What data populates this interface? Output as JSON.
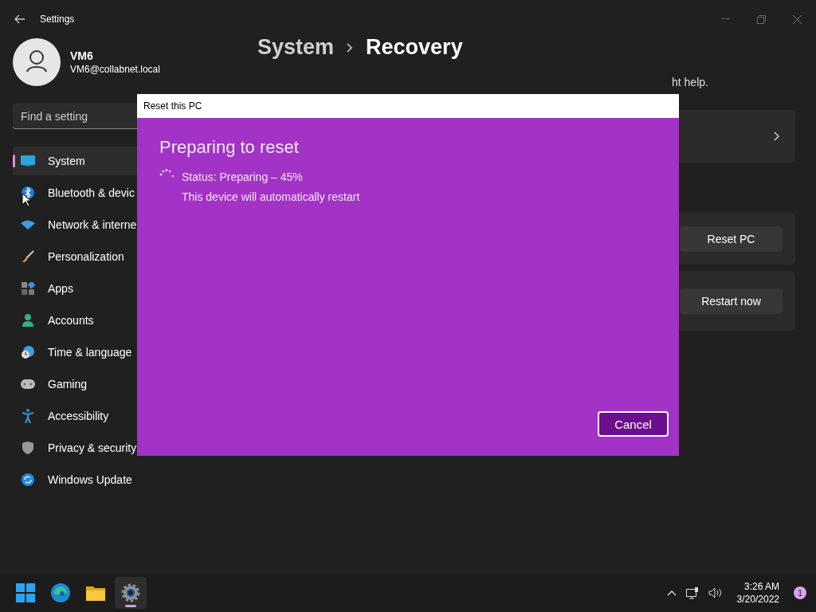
{
  "window": {
    "title": "Settings"
  },
  "user": {
    "name": "VM6",
    "email": "VM6@collabnet.local"
  },
  "search": {
    "placeholder": "Find a setting"
  },
  "sidebar": {
    "items": [
      {
        "label": "System",
        "kind": "system",
        "selected": true
      },
      {
        "label": "Bluetooth & devic",
        "kind": "bluetooth",
        "selected": false
      },
      {
        "label": "Network & interne",
        "kind": "network",
        "selected": false
      },
      {
        "label": "Personalization",
        "kind": "brush",
        "selected": false
      },
      {
        "label": "Apps",
        "kind": "apps",
        "selected": false
      },
      {
        "label": "Accounts",
        "kind": "account",
        "selected": false
      },
      {
        "label": "Time & language",
        "kind": "time",
        "selected": false
      },
      {
        "label": "Gaming",
        "kind": "gaming",
        "selected": false
      },
      {
        "label": "Accessibility",
        "kind": "accessibility",
        "selected": false
      },
      {
        "label": "Privacy & security",
        "kind": "shield",
        "selected": false
      },
      {
        "label": "Windows Update",
        "kind": "update",
        "selected": false
      }
    ]
  },
  "breadcrumb": {
    "parent": "System",
    "current": "Recovery"
  },
  "description_fragment": "ht help.",
  "cards": [
    {
      "kind": "link"
    },
    {
      "kind": "button",
      "button": "Reset PC"
    },
    {
      "kind": "button",
      "button": "Restart now"
    }
  ],
  "dialog": {
    "title": "Reset this PC",
    "heading": "Preparing to reset",
    "status": "Status: Preparing – 45%",
    "note": "This device will automatically restart",
    "button": "Cancel"
  },
  "taskbar": {
    "apps": [
      {
        "kind": "start",
        "selected": false
      },
      {
        "kind": "edge",
        "selected": false
      },
      {
        "kind": "folder",
        "selected": false
      },
      {
        "kind": "settings",
        "selected": true
      }
    ],
    "time": "3:26 AM",
    "date": "3/20/2022",
    "notifications": "1"
  }
}
